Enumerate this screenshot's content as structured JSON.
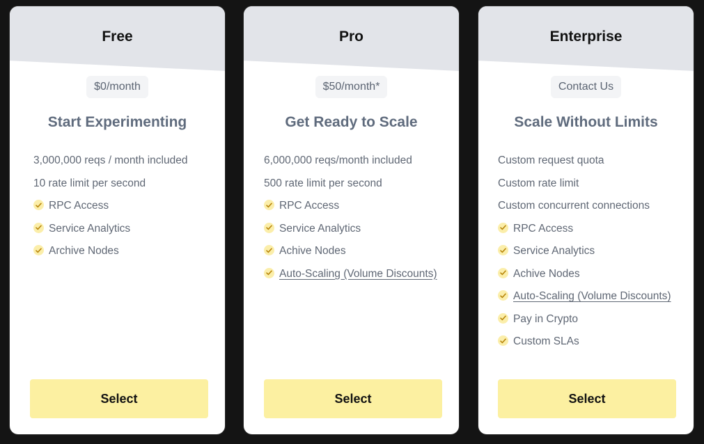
{
  "plans": [
    {
      "name": "Free",
      "price": "$0/month",
      "tagline": "Start Experimenting",
      "features": [
        {
          "text": "3,000,000 reqs / month included",
          "check": false,
          "link": false
        },
        {
          "text": "10 rate limit per second",
          "check": false,
          "link": false
        },
        {
          "text": "RPC Access",
          "check": true,
          "link": false
        },
        {
          "text": "Service Analytics",
          "check": true,
          "link": false
        },
        {
          "text": "Archive Nodes",
          "check": true,
          "link": false
        }
      ],
      "button": "Select"
    },
    {
      "name": "Pro",
      "price": "$50/month*",
      "tagline": "Get Ready to Scale",
      "features": [
        {
          "text": "6,000,000 reqs/month included",
          "check": false,
          "link": false
        },
        {
          "text": "500 rate limit per second",
          "check": false,
          "link": false
        },
        {
          "text": "RPC Access",
          "check": true,
          "link": false
        },
        {
          "text": "Service Analytics",
          "check": true,
          "link": false
        },
        {
          "text": "Achive Nodes",
          "check": true,
          "link": false
        },
        {
          "text": "Auto-Scaling (Volume Discounts)",
          "check": true,
          "link": true
        }
      ],
      "button": "Select"
    },
    {
      "name": "Enterprise",
      "price": "Contact Us",
      "tagline": "Scale Without Limits",
      "features": [
        {
          "text": "Custom request quota",
          "check": false,
          "link": false
        },
        {
          "text": "Custom rate limit",
          "check": false,
          "link": false
        },
        {
          "text": "Custom concurrent connections",
          "check": false,
          "link": false
        },
        {
          "text": "RPC Access",
          "check": true,
          "link": false
        },
        {
          "text": "Service Analytics",
          "check": true,
          "link": false
        },
        {
          "text": "Achive Nodes",
          "check": true,
          "link": false
        },
        {
          "text": "Auto-Scaling (Volume Discounts)",
          "check": true,
          "link": true
        },
        {
          "text": "Pay in Crypto",
          "check": true,
          "link": false
        },
        {
          "text": "Custom SLAs",
          "check": true,
          "link": false
        }
      ],
      "button": "Select"
    }
  ],
  "colors": {
    "background": "#141414",
    "card": "#ffffff",
    "header": "#e2e4e9",
    "button": "#fcf0a1",
    "check_bg": "#fbeeaa",
    "check_mark": "#b8860b",
    "muted_text": "#5f6774"
  },
  "icons": {
    "feature_check": "check-icon"
  }
}
